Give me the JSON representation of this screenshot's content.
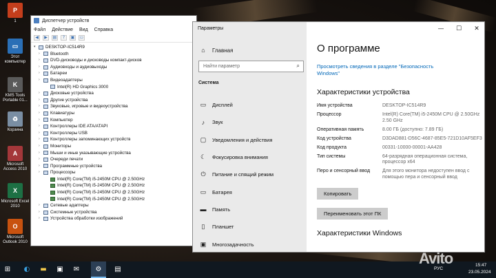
{
  "desktop_icons": [
    {
      "label": "1",
      "icon": "powerpoint-icon",
      "color": "#c43e1c",
      "glyph": "P"
    },
    {
      "label": "Этот компьютер",
      "icon": "computer-icon",
      "color": "#2a6fb6",
      "glyph": "▭"
    },
    {
      "label": "KMS Tools Portable 01...",
      "icon": "kms-tools-icon",
      "color": "#5a5a5a",
      "glyph": "K"
    },
    {
      "label": "Корзина",
      "icon": "recycle-bin-icon",
      "color": "#7a8ea3",
      "glyph": "♻"
    },
    {
      "label": "Microsoft Access 2010",
      "icon": "access-icon",
      "color": "#a4373a",
      "glyph": "A"
    },
    {
      "label": "Microsoft Excel 2010",
      "icon": "excel-icon",
      "color": "#1d7044",
      "glyph": "X"
    },
    {
      "label": "Microsoft Outlook 2010",
      "icon": "outlook-icon",
      "color": "#c8520f",
      "glyph": "O"
    }
  ],
  "device_manager": {
    "title": "Диспетчер устройств",
    "menu": [
      "Файл",
      "Действие",
      "Вид",
      "Справка"
    ],
    "root": "DESKTOP-IC514R9",
    "items": [
      {
        "label": "Bluetooth",
        "level": 1
      },
      {
        "label": "DVD-дисководы и дисководы компакт-дисков",
        "level": 1
      },
      {
        "label": "Аудиовходы и аудиовыходы",
        "level": 1
      },
      {
        "label": "Батареи",
        "level": 1
      },
      {
        "label": "Видеоадаптеры",
        "level": 1
      },
      {
        "label": "Intel(R) HD Graphics 3000",
        "level": 2
      },
      {
        "label": "Дисковые устройства",
        "level": 1
      },
      {
        "label": "Другие устройства",
        "level": 1
      },
      {
        "label": "Звуковые, игровые и видеоустройства",
        "level": 1
      },
      {
        "label": "Клавиатуры",
        "level": 1
      },
      {
        "label": "Компьютер",
        "level": 1
      },
      {
        "label": "Контроллеры IDE ATA/ATAPI",
        "level": 1
      },
      {
        "label": "Контроллеры USB",
        "level": 1
      },
      {
        "label": "Контроллеры запоминающих устройств",
        "level": 1
      },
      {
        "label": "Мониторы",
        "level": 1
      },
      {
        "label": "Мыши и иные указывающие устройства",
        "level": 1
      },
      {
        "label": "Очереди печати",
        "level": 1
      },
      {
        "label": "Программные устройства",
        "level": 1
      },
      {
        "label": "Процессоры",
        "level": 1
      },
      {
        "label": "Intel(R) Core(TM) i5-2450M CPU @ 2.50GHz",
        "level": 2,
        "cpu": true
      },
      {
        "label": "Intel(R) Core(TM) i5-2450M CPU @ 2.50GHz",
        "level": 2,
        "cpu": true
      },
      {
        "label": "Intel(R) Core(TM) i5-2450M CPU @ 2.50GHz",
        "level": 2,
        "cpu": true
      },
      {
        "label": "Intel(R) Core(TM) i5-2450M CPU @ 2.50GHz",
        "level": 2,
        "cpu": true
      },
      {
        "label": "Сетевые адаптеры",
        "level": 1
      },
      {
        "label": "Системные устройства",
        "level": 1
      },
      {
        "label": "Устройства обработки изображений",
        "level": 1
      }
    ]
  },
  "settings": {
    "app_title": "Параметры",
    "window_buttons": {
      "minimize": "—",
      "maximize": "☐",
      "close": "✕"
    },
    "home": "Главная",
    "search_placeholder": "Найти параметр",
    "section": "Система",
    "nav": [
      {
        "label": "Дисплей",
        "icon": "display-icon",
        "glyph": "▭"
      },
      {
        "label": "Звук",
        "icon": "sound-icon",
        "glyph": "♪"
      },
      {
        "label": "Уведомления и действия",
        "icon": "notifications-icon",
        "glyph": "▢"
      },
      {
        "label": "Фокусировка внимания",
        "icon": "focus-assist-icon",
        "glyph": "☾"
      },
      {
        "label": "Питание и спящий режим",
        "icon": "power-icon",
        "glyph": "⏻"
      },
      {
        "label": "Батарея",
        "icon": "battery-icon",
        "glyph": "▭"
      },
      {
        "label": "Память",
        "icon": "storage-icon",
        "glyph": "▬"
      },
      {
        "label": "Планшет",
        "icon": "tablet-icon",
        "glyph": "▯"
      },
      {
        "label": "Многозадачность",
        "icon": "multitasking-icon",
        "glyph": "▣"
      }
    ],
    "page_title": "О программе",
    "security_link": "Просмотреть сведения в разделе \"Безопасность Windows\"",
    "device_specs_title": "Характеристики устройства",
    "specs": [
      {
        "key": "Имя устройства",
        "value": "DESKTOP-IC514R9"
      },
      {
        "key": "Процессор",
        "value": "Intel(R) Core(TM) i5-2450M CPU @ 2.50GHz   2.50 GHz"
      },
      {
        "key": "Оперативная память",
        "value": "8.00 ГБ (доступно: 7.89 ГБ)"
      },
      {
        "key": "Код устройства",
        "value": "D3DAD881-D56C-4687-85E5-721D10AF5EF3"
      },
      {
        "key": "Код продукта",
        "value": "00331-10000-00001-AA428"
      },
      {
        "key": "Тип системы",
        "value": "64-разрядная операционная система, процессор x64"
      },
      {
        "key": "Перо и сенсорный ввод",
        "value": "Для этого монитора недоступен ввод с помощью пера и сенсорный ввод"
      }
    ],
    "copy_button": "Копировать",
    "rename_button": "Переименовать этот ПК",
    "windows_specs_title": "Характеристики Windows"
  },
  "taskbar": {
    "time": "15:47",
    "date": "23.05.2024",
    "language": "РУС",
    "accent": "#76b9ed"
  },
  "watermark": "Avito"
}
